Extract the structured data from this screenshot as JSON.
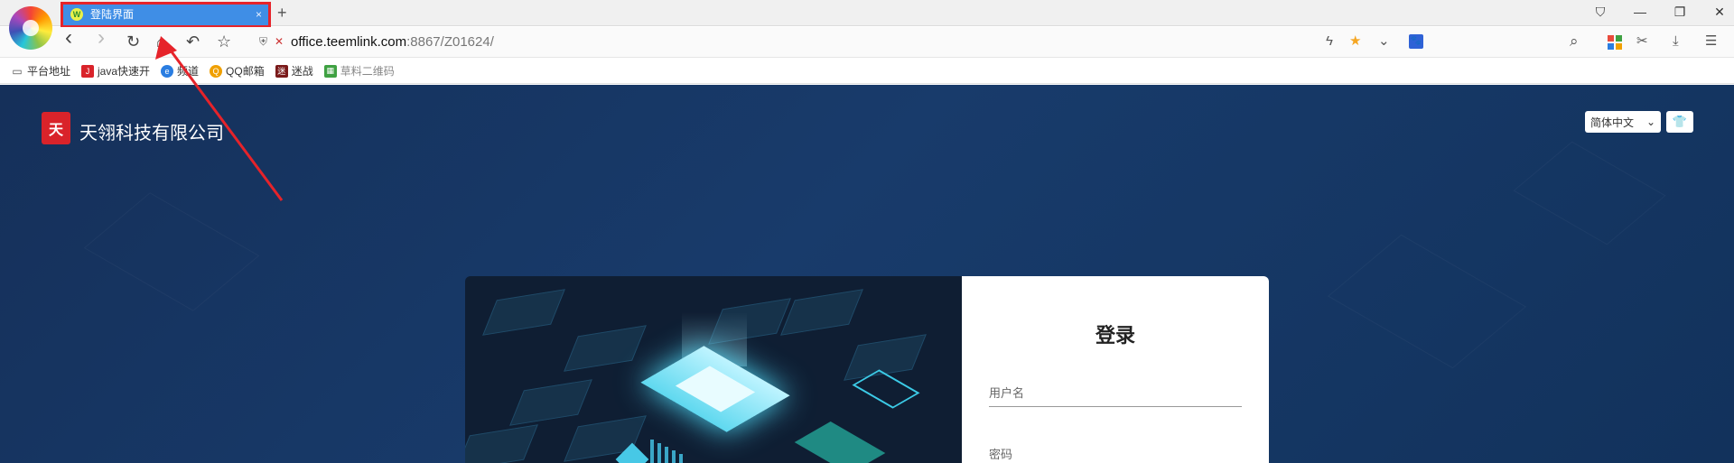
{
  "browser": {
    "tab": {
      "title": "登陆界面",
      "favicon_letter": "W",
      "close": "×"
    },
    "new_tab": "+",
    "window_controls": [
      "⛉",
      "—",
      "❐",
      "✕"
    ],
    "toolbar": {
      "back": "‹",
      "forward": "›",
      "reload": "↻",
      "home": "⌂",
      "undo": "↶",
      "star": "☆",
      "url_host": "office.teemlink.com",
      "url_rest": ":8867/Z01624/",
      "bolt": "ϟ",
      "fav": "★",
      "chevron": "⌄",
      "search": "⌕",
      "cut": "✂",
      "download": "⤓",
      "menu": "☰"
    },
    "bookmarks": [
      {
        "label": "平台地址",
        "icon": "folder-icon",
        "color": "#555555",
        "glyph": "▭"
      },
      {
        "label": "java快速开",
        "icon": "java-icon",
        "color": "#d9232a",
        "glyph": "J"
      },
      {
        "label": "频道",
        "icon": "channel-icon",
        "color": "#2a7de1",
        "glyph": "e"
      },
      {
        "label": "QQ邮箱",
        "icon": "qq-mail-icon",
        "color": "#f0a000",
        "glyph": "Q"
      },
      {
        "label": "迷战",
        "icon": "game-icon",
        "color": "#7a1a1a",
        "glyph": "迷"
      },
      {
        "label": "草料二维码",
        "icon": "qrcode-icon",
        "color": "#3fa142",
        "glyph": "▦"
      }
    ]
  },
  "page": {
    "company_logo_glyph": "天",
    "company_name": "天翎科技有限公司",
    "language": "简体中文",
    "language_chevron": "⌄",
    "skin_icon": "👕",
    "login": {
      "title": "登录",
      "username_placeholder": "用户名",
      "password_placeholder": "密码"
    }
  },
  "colors": {
    "tab_active": "#3f8ee6",
    "highlight": "#e6232a",
    "page_bg": "#183b6b",
    "accent_cyan": "#4fd6f2"
  }
}
